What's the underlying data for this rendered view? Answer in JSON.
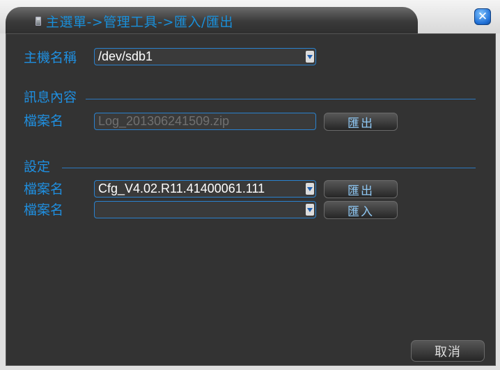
{
  "title": {
    "breadcrumb": "主選單->管理工具->匯入/匯出",
    "icon": "disk-icon",
    "close_icon": "close-icon",
    "close_symbol": "✕"
  },
  "host": {
    "label": "主機名稱",
    "device_value": "/dev/sdb1"
  },
  "log_section": {
    "heading": "訊息內容",
    "file_label": "檔案名",
    "file_value": "Log_201306241509.zip",
    "export_label": "匯出"
  },
  "settings_section": {
    "heading": "設定",
    "export_row": {
      "file_label": "檔案名",
      "file_value": "Cfg_V4.02.R11.41400061.111",
      "button_label": "匯出"
    },
    "import_row": {
      "file_label": "檔案名",
      "file_value": "",
      "button_label": "匯入"
    }
  },
  "footer": {
    "cancel_label": "取消"
  },
  "colors": {
    "accent_text": "#1f8fe0",
    "panel_bg": "#333333",
    "field_border": "#2a82cf",
    "close_button": "#1f6fd6"
  }
}
